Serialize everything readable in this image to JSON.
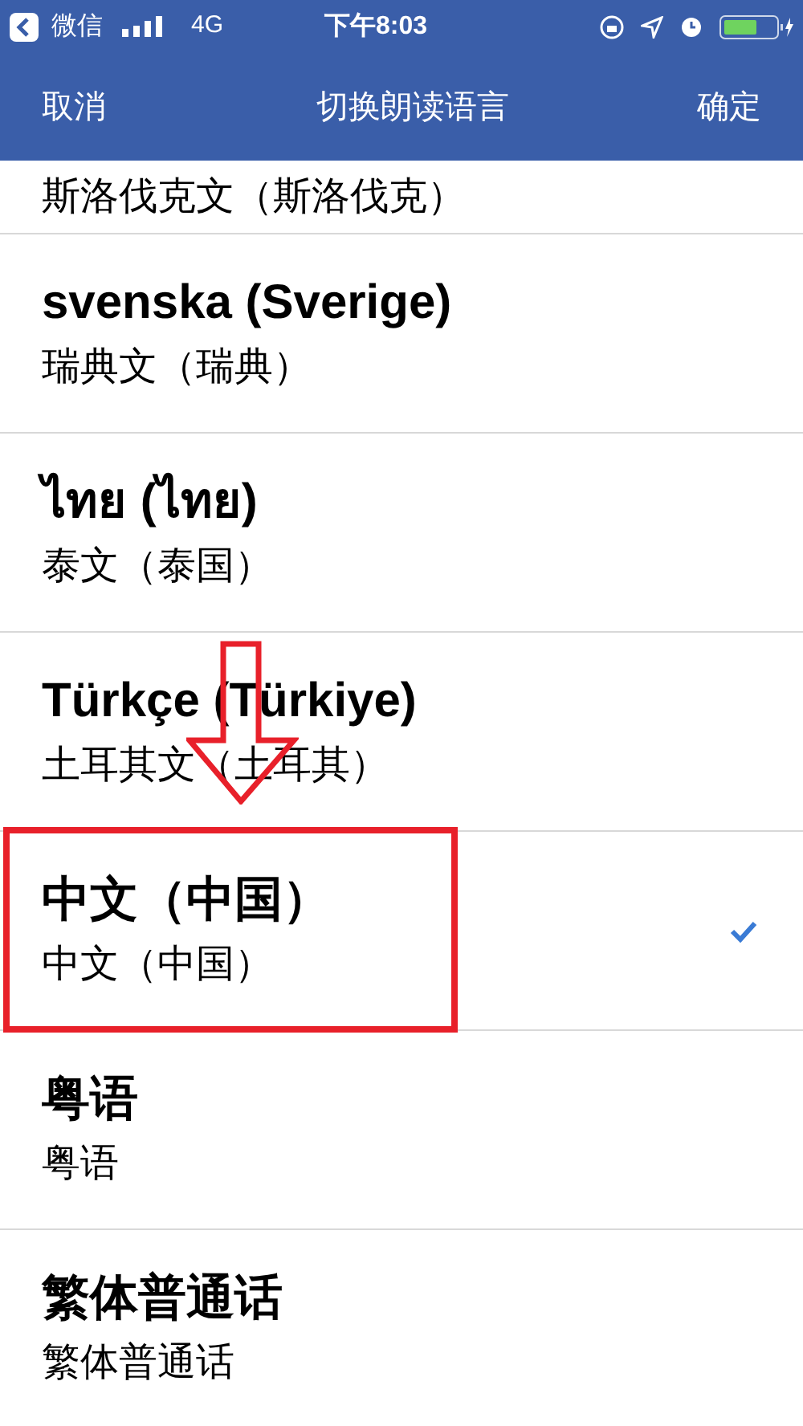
{
  "status_bar": {
    "back_app": "微信",
    "network": "4G",
    "time": "下午8:03"
  },
  "nav": {
    "cancel": "取消",
    "title": "切换朗读语言",
    "confirm": "确定"
  },
  "languages": [
    {
      "subtitle": "斯洛伐克文（斯洛伐克）",
      "selected": false,
      "highlighted": false
    },
    {
      "title": "svenska (Sverige)",
      "subtitle": "瑞典文（瑞典）",
      "selected": false,
      "highlighted": false
    },
    {
      "title": "ไทย (ไทย)",
      "subtitle": "泰文（泰国）",
      "selected": false,
      "highlighted": false
    },
    {
      "title": "Türkçe (Türkiye)",
      "subtitle": "土耳其文（土耳其）",
      "selected": false,
      "highlighted": false
    },
    {
      "title": "中文（中国）",
      "subtitle": "中文（中国）",
      "selected": true,
      "highlighted": true
    },
    {
      "title": "粤语",
      "subtitle": "粤语",
      "selected": false,
      "highlighted": false
    },
    {
      "title": "繁体普通话",
      "subtitle": "繁体普通话",
      "selected": false,
      "highlighted": false
    }
  ]
}
